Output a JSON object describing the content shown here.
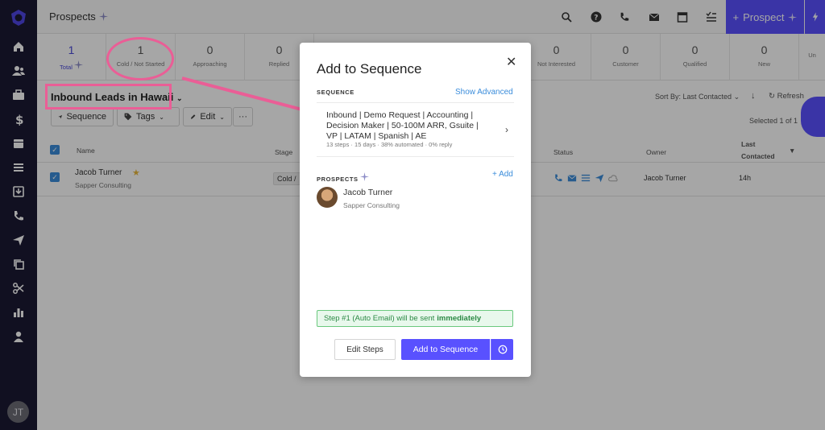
{
  "app": {
    "page_title": "Prospects",
    "add_prospect_label": "Prospect",
    "user_initials": "JT",
    "accent_color": "#5951ff"
  },
  "topbar_icons": [
    "search-icon",
    "help-icon",
    "phone-icon",
    "mail-icon",
    "calendar-icon",
    "tasks-icon"
  ],
  "sidebar_icons": [
    "home-icon",
    "people-icon",
    "briefcase-icon",
    "dollar-icon",
    "calendar-icon",
    "tasks-icon",
    "inbox-icon",
    "phone-icon",
    "send-icon",
    "copy-icon",
    "scissors-icon",
    "chart-icon",
    "person-icon"
  ],
  "stages": [
    {
      "count": "1",
      "label": "Total"
    },
    {
      "count": "1",
      "label": "Cold / Not Started"
    },
    {
      "count": "0",
      "label": "Approaching"
    },
    {
      "count": "0",
      "label": "Replied"
    },
    {
      "count": "0",
      "label": "Not Interested"
    },
    {
      "count": "0",
      "label": "Customer"
    },
    {
      "count": "0",
      "label": "Qualified"
    },
    {
      "count": "0",
      "label": "New"
    },
    {
      "count": "",
      "label": "Un"
    }
  ],
  "view": {
    "title": "Inbound Leads in Hawaii",
    "buttons": {
      "sequence": "Sequence",
      "tags": "Tags",
      "edit": "Edit",
      "more": "···"
    },
    "sort_label": "Sort By: Last Contacted",
    "refresh_label": "Refresh",
    "selected_label": "Selected 1 of 1"
  },
  "table": {
    "headers": {
      "name": "Name",
      "stage": "Stage",
      "status": "Status",
      "owner": "Owner",
      "last_contacted_1": "Last",
      "last_contacted_2": "Contacted"
    },
    "rows": [
      {
        "name": "Jacob Turner",
        "company": "Sapper Consulting",
        "stage": "Cold /",
        "owner": "Jacob Turner",
        "last_contacted": "14h"
      }
    ]
  },
  "modal": {
    "title": "Add to Sequence",
    "close": "✕",
    "sequence_label": "SEQUENCE",
    "show_advanced": "Show Advanced",
    "sequence_name": "Inbound | Demo Request | Accounting | Decision Maker | 50-100M ARR, Gsuite | VP | LATAM | Spanish | AE",
    "sequence_meta": "13 steps  ·  15 days  ·  38% automated  ·  0% reply",
    "prospects_label": "PROSPECTS",
    "add_link": "+ Add",
    "prospect_name": "Jacob Turner",
    "prospect_company": "Sapper Consulting",
    "notice_prefix": "Step #1 (Auto Email) will be sent",
    "notice_emphasis": "immediately",
    "edit_steps": "Edit Steps",
    "add_to_sequence": "Add to Sequence"
  }
}
